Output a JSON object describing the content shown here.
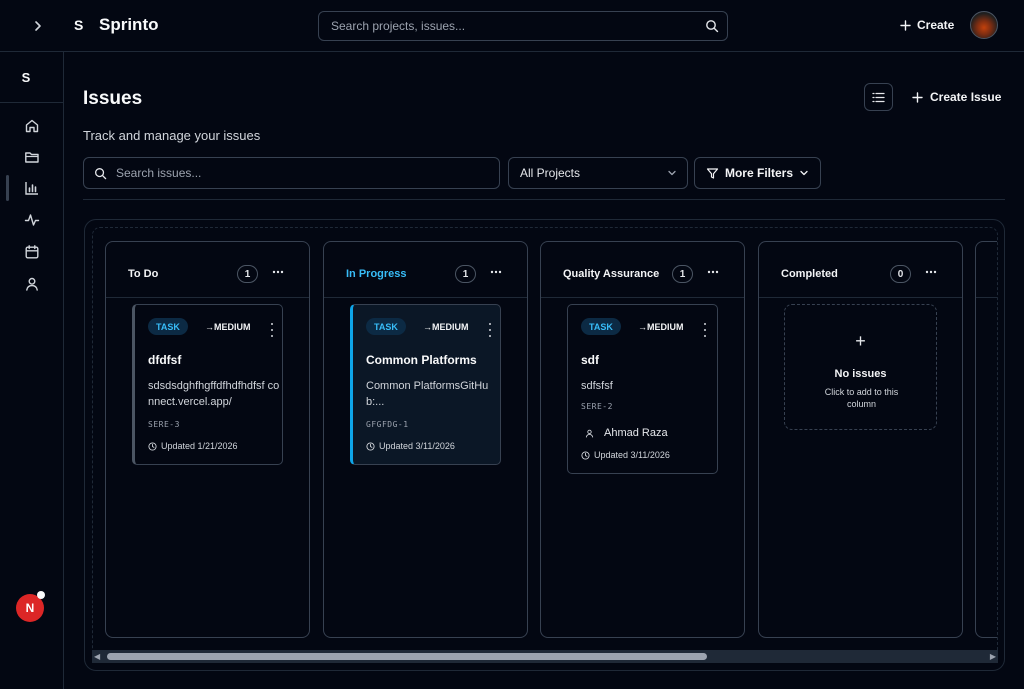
{
  "topbar": {
    "expand_icon": "chevron-right-icon",
    "brand_initial": "S",
    "brand_name": "Sprinto",
    "search_placeholder": "Search projects, issues...",
    "create_label": "Create"
  },
  "sidebar": {
    "initial": "S",
    "items": [
      {
        "icon": "home-icon"
      },
      {
        "icon": "folder-icon"
      },
      {
        "icon": "chart-icon"
      },
      {
        "icon": "activity-icon"
      },
      {
        "icon": "calendar-icon"
      },
      {
        "icon": "user-icon"
      }
    ],
    "notification_initial": "N"
  },
  "header": {
    "title": "Issues",
    "subtitle": "Track and manage your issues",
    "create_issue_label": "Create Issue"
  },
  "filters": {
    "search_placeholder": "Search issues...",
    "project_select": "All Projects",
    "more_filters_label": "More Filters"
  },
  "board": {
    "columns": [
      {
        "title": "To Do",
        "count": "1",
        "cards": [
          {
            "type": "TASK",
            "priority": "→MEDIUM",
            "title": "dfdfsf",
            "description": "sdsdsdghfhgffdfhdfhdfsf connect.vercel.app/",
            "key": "SERE-3",
            "updated": "Updated 1/21/2026"
          }
        ]
      },
      {
        "title": "In Progress",
        "count": "1",
        "cards": [
          {
            "type": "TASK",
            "priority": "→MEDIUM",
            "title": "Common Platforms",
            "description": "Common PlatformsGitHub:...",
            "key": "GFGFDG-1",
            "updated": "Updated 3/11/2026"
          }
        ]
      },
      {
        "title": "Quality Assurance",
        "count": "1",
        "cards": [
          {
            "type": "TASK",
            "priority": "→MEDIUM",
            "title": "sdf",
            "description": "sdfsfsf",
            "key": "SERE-2",
            "assignee": "Ahmad Raza",
            "updated": "Updated 3/11/2026"
          }
        ]
      },
      {
        "title": "Completed",
        "count": "0",
        "empty": {
          "plus": "+",
          "title": "No issues",
          "subtitle": "Click to add to this column"
        }
      }
    ]
  },
  "colors": {
    "background": "#030712",
    "border": "#374151",
    "accent": "#38bdf8",
    "tag_bg": "#0c2a44",
    "notification": "#dc2626"
  }
}
